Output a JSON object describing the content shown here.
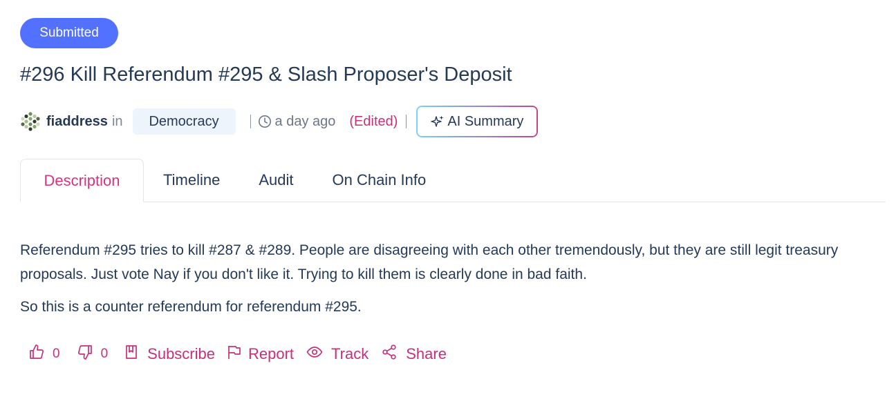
{
  "post": {
    "status": "Submitted",
    "title": "#296 Kill Referendum #295 & Slash Proposer's Deposit",
    "author": "fiaddress",
    "in_word": "in",
    "topic": "Democracy",
    "time": "a day ago",
    "edited": "(Edited)",
    "ai_summary_label": "AI Summary"
  },
  "tabs": [
    {
      "label": "Description",
      "active": true
    },
    {
      "label": "Timeline"
    },
    {
      "label": "Audit"
    },
    {
      "label": "On Chain Info"
    }
  ],
  "content": {
    "paragraphs": [
      "Referendum #295 tries to kill #287 & #289. People are disagreeing with each other tremendously, but they are still legit treasury proposals. Just vote Nay if you don't like it. Trying to kill them is clearly done in bad faith.",
      "So this is a counter referendum for referendum #295."
    ]
  },
  "actions": {
    "likes": "0",
    "dislikes": "0",
    "subscribe": "Subscribe",
    "report": "Report",
    "track": "Track",
    "share": "Share"
  },
  "colors": {
    "accent": "#D63384",
    "status": "#5271FF",
    "text": "#243A57"
  },
  "icons": [
    "avatar-identicon",
    "clock-icon",
    "sparkle-icon",
    "thumbs-up-icon",
    "thumbs-down-icon",
    "bookmark-icon",
    "flag-icon",
    "eye-icon",
    "share-icon"
  ]
}
